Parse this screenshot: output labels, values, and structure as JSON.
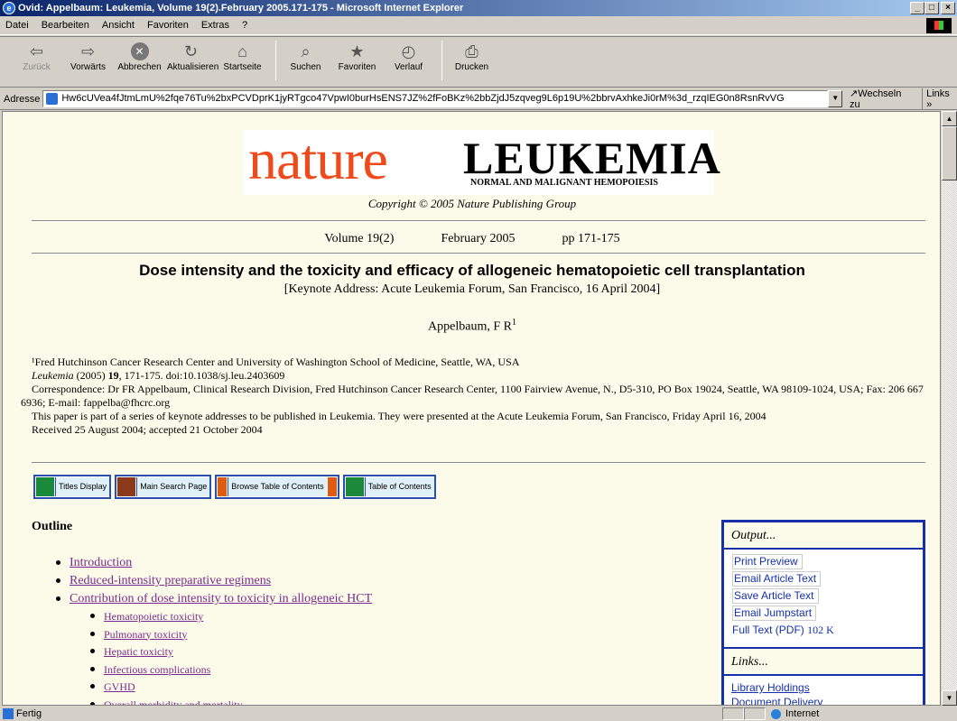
{
  "window": {
    "title": "Ovid: Appelbaum: Leukemia, Volume 19(2).February 2005.171-175 - Microsoft Internet Explorer",
    "buttons": {
      "minimize": "_",
      "maximize": "×",
      "close": "×"
    }
  },
  "menubar": [
    "Datei",
    "Bearbeiten",
    "Ansicht",
    "Favoriten",
    "Extras",
    "?"
  ],
  "toolbar": [
    {
      "label": "Zurück",
      "icon": "back-arrow-icon",
      "glyph": "⇦",
      "disabled": true
    },
    {
      "label": "Vorwärts",
      "icon": "forward-arrow-icon",
      "glyph": "⇨",
      "disabled": false
    },
    {
      "label": "Abbrechen",
      "icon": "stop-icon",
      "glyph": "✕",
      "disabled": false
    },
    {
      "label": "Aktualisieren",
      "icon": "refresh-icon",
      "glyph": "↻",
      "disabled": false
    },
    {
      "label": "Startseite",
      "icon": "home-icon",
      "glyph": "⌂",
      "disabled": false
    },
    {
      "label": "Suchen",
      "icon": "search-icon",
      "glyph": "⌕",
      "disabled": false
    },
    {
      "label": "Favoriten",
      "icon": "favorites-icon",
      "glyph": "★",
      "disabled": false
    },
    {
      "label": "Verlauf",
      "icon": "history-icon",
      "glyph": "◴",
      "disabled": false
    },
    {
      "label": "Drucken",
      "icon": "print-icon",
      "glyph": "⎙",
      "disabled": false
    }
  ],
  "address": {
    "label": "Adresse",
    "url": "Hw6cUVea4fJtmLmU%2fqe76Tu%2bxPCVDprK1jyRTgco47VpwI0burHsENS7JZ%2fFoBKz%2bbZjdJ5zqveg9L6p19U%2bbrvAxhkeJi0rM%3d_rzqIEG0n8RsnRvVG",
    "go": "Wechseln zu",
    "links": "Links"
  },
  "page": {
    "logo_nature": "nature",
    "logo_journal": "LEUKEMIA",
    "logo_subtitle": "NORMAL AND MALIGNANT HEMOPOIESIS",
    "copyright": "Copyright © 2005 Nature Publishing Group",
    "volume": "Volume 19(2)",
    "date": "February 2005",
    "pages": "pp 171-175",
    "title": "Dose intensity and the toxicity and efficacy of allogeneic hematopoietic cell transplantation",
    "keynote": "[Keynote Address: Acute Leukemia Forum, San Francisco, 16 April 2004]",
    "author": "Appelbaum, F R",
    "author_sup": "1",
    "affiliation": "¹Fred Hutchinson Cancer Research Center and University of Washington School of Medicine, Seattle, WA, USA",
    "citation_journal": "Leukemia",
    "citation_year": " (2005) ",
    "citation_vol": "19",
    "citation_rest": ", 171-175. doi:10.1038/sj.leu.2403609",
    "correspondence": "Correspondence: Dr FR Appelbaum, Clinical Research Division, Fred Hutchinson Cancer Research Center, 1100 Fairview Avenue, N., D5-310, PO Box 19024, Seattle, WA 98109-1024, USA; Fax: 206 667 6936; E-mail: fappelba@fhcrc.org",
    "series_note": "This paper is part of a series of keynote addresses to be published in Leukemia. They were presented at the Acute Leukemia Forum, San Francisco, Friday April 16, 2004",
    "received": "Received 25 August 2004; accepted 21 October 2004"
  },
  "nav_buttons": [
    {
      "label": "Titles Display",
      "icon": "titles-display-icon",
      "color": "#1a8a3a"
    },
    {
      "label": "Main Search Page",
      "icon": "home-icon",
      "color": "#8a3a1a"
    },
    {
      "label": "Browse Table of Contents",
      "icon": "browse-arrows-icon",
      "color": "#e05a10"
    },
    {
      "label": "Table of Contents",
      "icon": "table-of-contents-icon",
      "color": "#1a8a3a"
    }
  ],
  "outline": {
    "heading": "Outline",
    "items": [
      {
        "text": "Introduction",
        "level": 1
      },
      {
        "text": "Reduced-intensity preparative regimens",
        "level": 1
      },
      {
        "text": "Contribution of dose intensity to toxicity in allogeneic HCT",
        "level": 1
      },
      {
        "text": "Hematopoietic toxicity",
        "level": 2
      },
      {
        "text": "Pulmonary toxicity",
        "level": 2
      },
      {
        "text": "Hepatic toxicity",
        "level": 2
      },
      {
        "text": "Infectious complications",
        "level": 2
      },
      {
        "text": "GVHD",
        "level": 2
      },
      {
        "text": "Overall morbidity and mortality",
        "level": 2
      }
    ]
  },
  "sidebox": {
    "output_heading": "Output...",
    "output_items": [
      "Print Preview",
      "Email Article Text",
      "Save Article Text",
      "Email Jumpstart"
    ],
    "pdf_label": "Full Text (PDF)",
    "pdf_size": "102 K",
    "links_heading": "Links...",
    "links": [
      "Library Holdings",
      "Document Delivery"
    ]
  },
  "status": {
    "text": "Fertig",
    "zone": "Internet"
  }
}
